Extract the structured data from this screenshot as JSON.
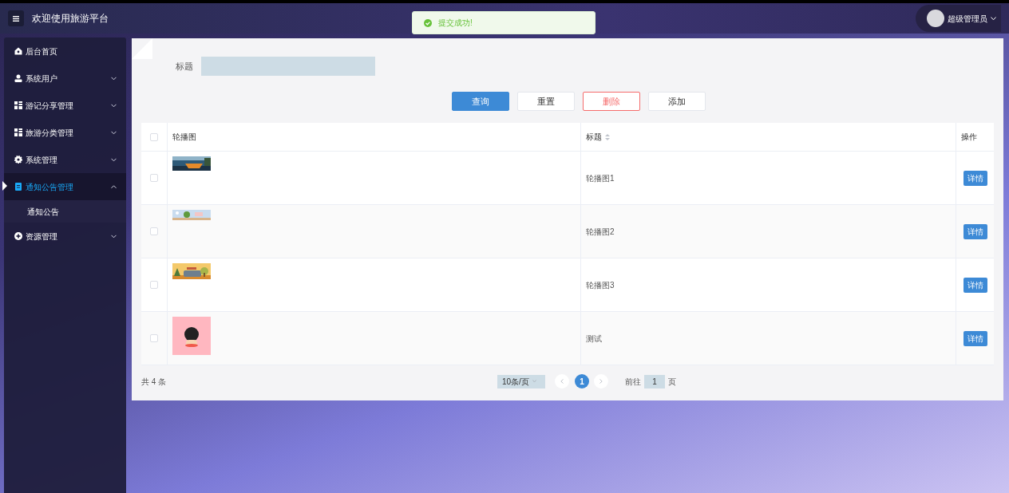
{
  "header": {
    "title": "欢迎使用旅游平台",
    "user": "超级管理员"
  },
  "toast": {
    "kind": "success",
    "text": "提交成功!"
  },
  "sidebar": {
    "items": [
      {
        "label": "后台首页",
        "kind": "link",
        "selected": false
      },
      {
        "label": "系统用户",
        "kind": "menu",
        "expanded": false,
        "selected": false
      },
      {
        "label": "游记分享管理",
        "kind": "menu",
        "expanded": false,
        "selected": false
      },
      {
        "label": "旅游分类管理",
        "kind": "menu",
        "expanded": false,
        "selected": false
      },
      {
        "label": "系统管理",
        "kind": "menu",
        "expanded": false,
        "selected": false
      },
      {
        "label": "通知公告管理",
        "kind": "menu",
        "expanded": true,
        "selected": true,
        "children": [
          {
            "label": "通知公告",
            "selected": true
          }
        ]
      },
      {
        "label": "资源管理",
        "kind": "menu",
        "expanded": false,
        "selected": false
      }
    ]
  },
  "search": {
    "label": "标题"
  },
  "buttons": [
    {
      "label": "查询",
      "kind": "primary"
    },
    {
      "label": "重置",
      "kind": "default"
    },
    {
      "label": "删除",
      "kind": "danger"
    },
    {
      "label": "添加",
      "kind": "default"
    }
  ],
  "table": {
    "all_checked": false,
    "columns": [
      {
        "label": "轮播图",
        "sortable": false
      },
      {
        "label": "标题",
        "sortable": true
      },
      {
        "label": "操作",
        "sortable": false
      }
    ],
    "rows": [
      {
        "checked": false,
        "title": "轮播图1",
        "action": "详情"
      },
      {
        "checked": false,
        "title": "轮播图2",
        "action": "详情"
      },
      {
        "checked": false,
        "title": "轮播图3",
        "action": "详情"
      },
      {
        "checked": false,
        "title": "测试",
        "action": "详情"
      }
    ]
  },
  "pagination": {
    "total": "共 4 条",
    "page_size": "10条/页",
    "pages": [
      {
        "label": "1",
        "selected": true
      }
    ],
    "goto_label": "前往",
    "goto_value": "1",
    "goto_suffix": "页"
  }
}
